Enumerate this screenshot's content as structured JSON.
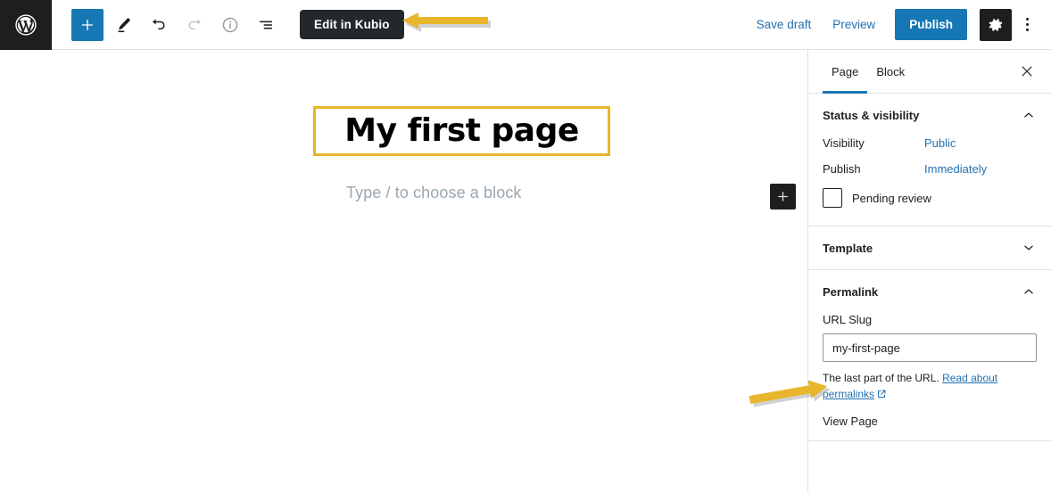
{
  "topbar": {
    "logo_icon": "wordpress-logo-icon",
    "tools": [
      {
        "name": "block-inserter-toggle",
        "icon": "plus-icon",
        "label": "Toggle block inserter"
      },
      {
        "name": "edit-tools-mode",
        "icon": "pencil-icon",
        "label": "Tools"
      },
      {
        "name": "undo-button",
        "icon": "undo-arrow-icon",
        "label": "Undo"
      },
      {
        "name": "redo-button",
        "icon": "redo-arrow-icon",
        "label": "Redo"
      },
      {
        "name": "details-button",
        "icon": "info-circle-icon",
        "label": "Details"
      },
      {
        "name": "list-view-button",
        "icon": "list-view-icon",
        "label": "List View"
      }
    ],
    "kubio_label": "Edit in Kubio",
    "save_draft_label": "Save draft",
    "preview_label": "Preview",
    "publish_label": "Publish",
    "settings_icon": "gear-icon",
    "more_icon": "more-vertical-dots-icon",
    "accent_blue": "#1677b5",
    "link_blue": "#2271b1",
    "dark": "#1e1e1e"
  },
  "editor": {
    "post_title": "My first page",
    "paragraph_placeholder": "Type / to choose a block",
    "inserter_icon": "plus-icon",
    "title_highlight_color": "#e8b52b"
  },
  "sidebar": {
    "tabs": [
      {
        "label": "Page",
        "active": true
      },
      {
        "label": "Block",
        "active": false
      }
    ],
    "close_icon": "close-icon",
    "panels": [
      {
        "title": "Status & visibility",
        "expanded": true,
        "chevron": "chevron-up-icon",
        "rows": [
          {
            "label": "Visibility",
            "value": "Public"
          },
          {
            "label": "Publish",
            "value": "Immediately"
          }
        ],
        "checkbox": {
          "label": "Pending review",
          "checked": false
        }
      },
      {
        "title": "Template",
        "expanded": false,
        "chevron": "chevron-down-icon"
      },
      {
        "title": "Permalink",
        "expanded": true,
        "chevron": "chevron-up-icon",
        "slug_label": "URL Slug",
        "slug_value": "my-first-page",
        "slug_placeholder": "my-first-page",
        "help_prefix": "The last part of the URL.",
        "help_link": "Read about permalinks",
        "external_link_icon": "external-link-icon",
        "view_page_label": "View Page"
      }
    ]
  },
  "annotations": {
    "arrow_color": "#e8b52b",
    "arrows": [
      {
        "name": "arrow-pointing-to-kubio-button",
        "direction": "left"
      },
      {
        "name": "arrow-pointing-to-url-slug-input",
        "direction": "right"
      }
    ]
  }
}
